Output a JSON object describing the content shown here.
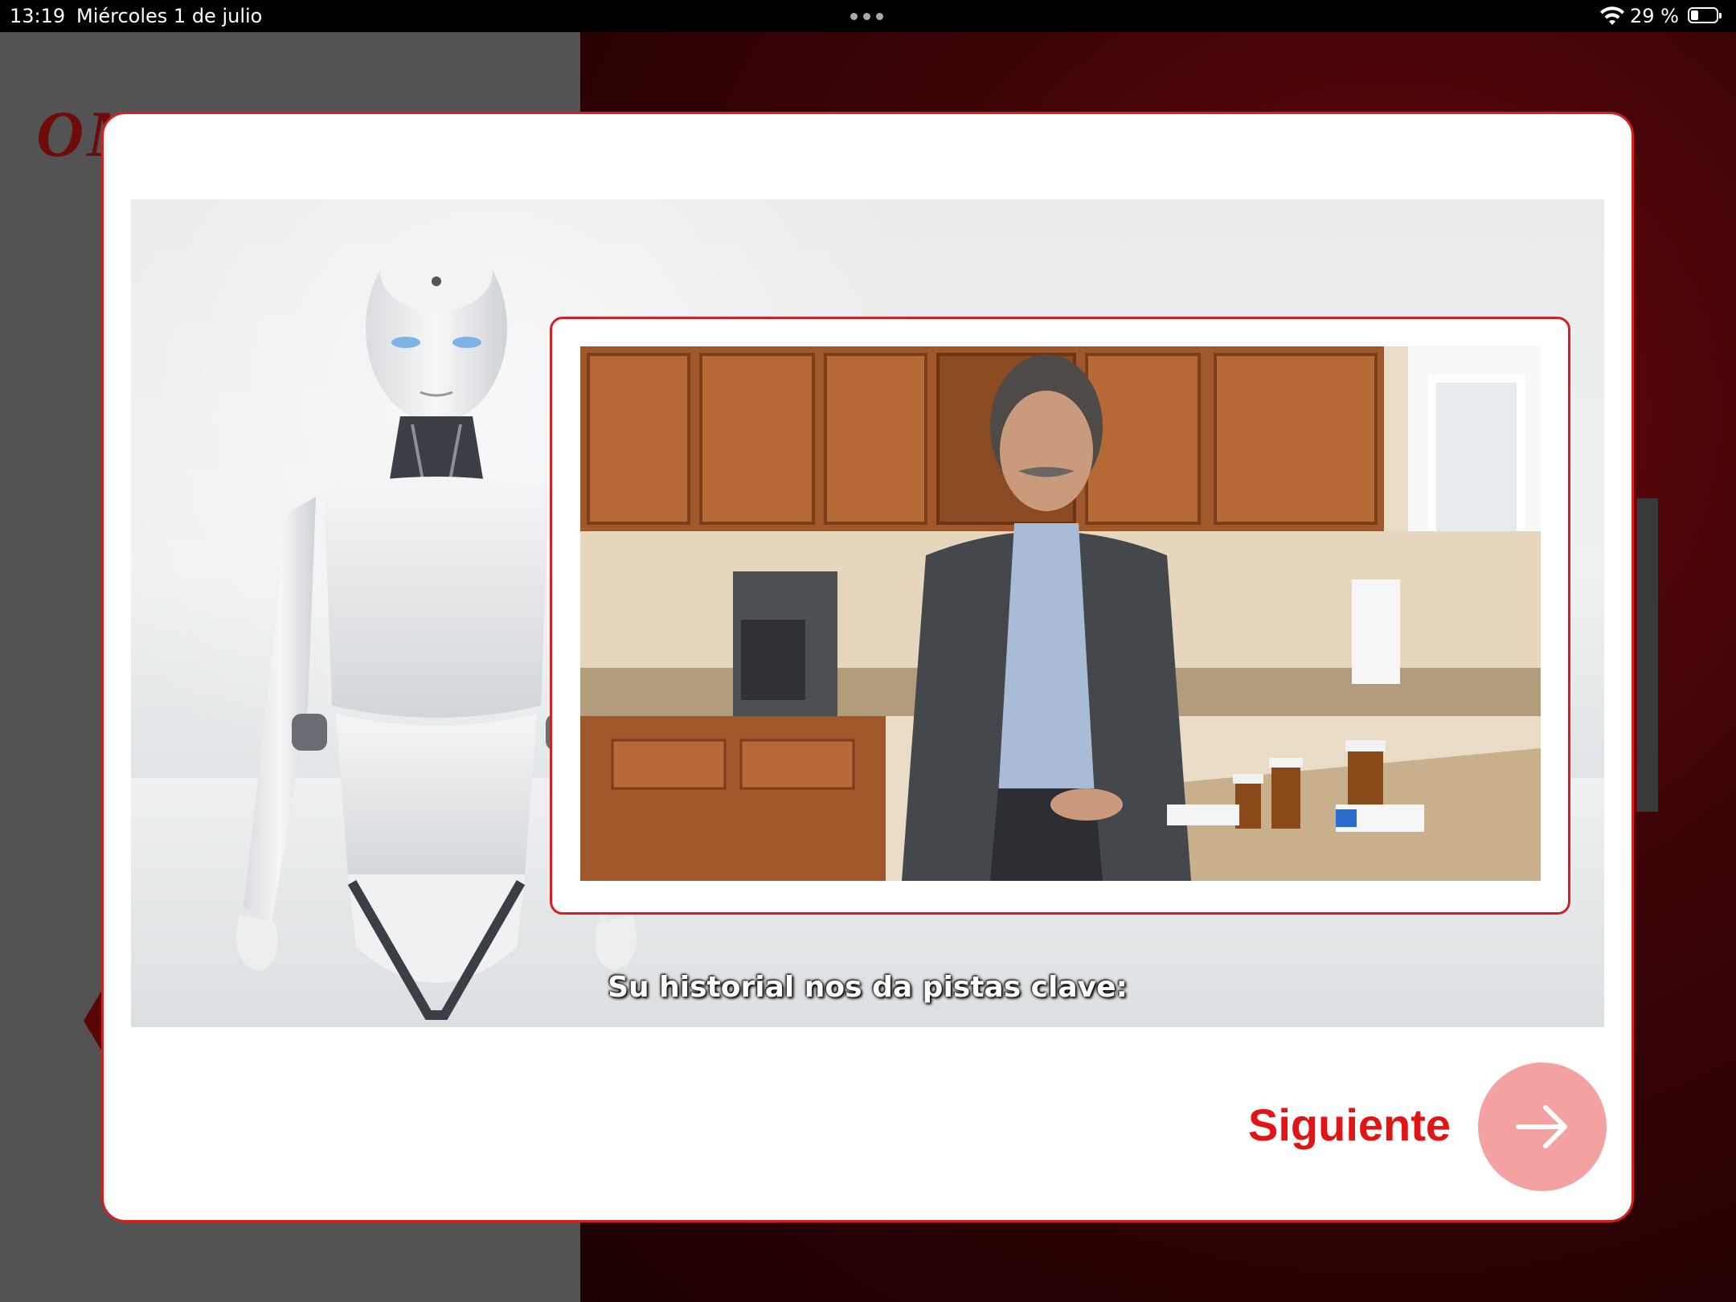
{
  "status_bar": {
    "time": "13:19",
    "date": "Miércoles 1 de julio",
    "battery_percent": "29 %",
    "battery_level": 0.29,
    "icons": [
      "wifi-icon",
      "battery-icon",
      "multitask-dots-icon"
    ]
  },
  "backdrop": {
    "logo_text": "OM"
  },
  "modal": {
    "caption": "Su historial nos da pistas clave:",
    "next_label": "Siguiente",
    "next_icon": "arrow-right-icon"
  },
  "colors": {
    "accent": "#d42021",
    "next_text": "#e11515",
    "next_button_bg": "#f4a1a1"
  }
}
